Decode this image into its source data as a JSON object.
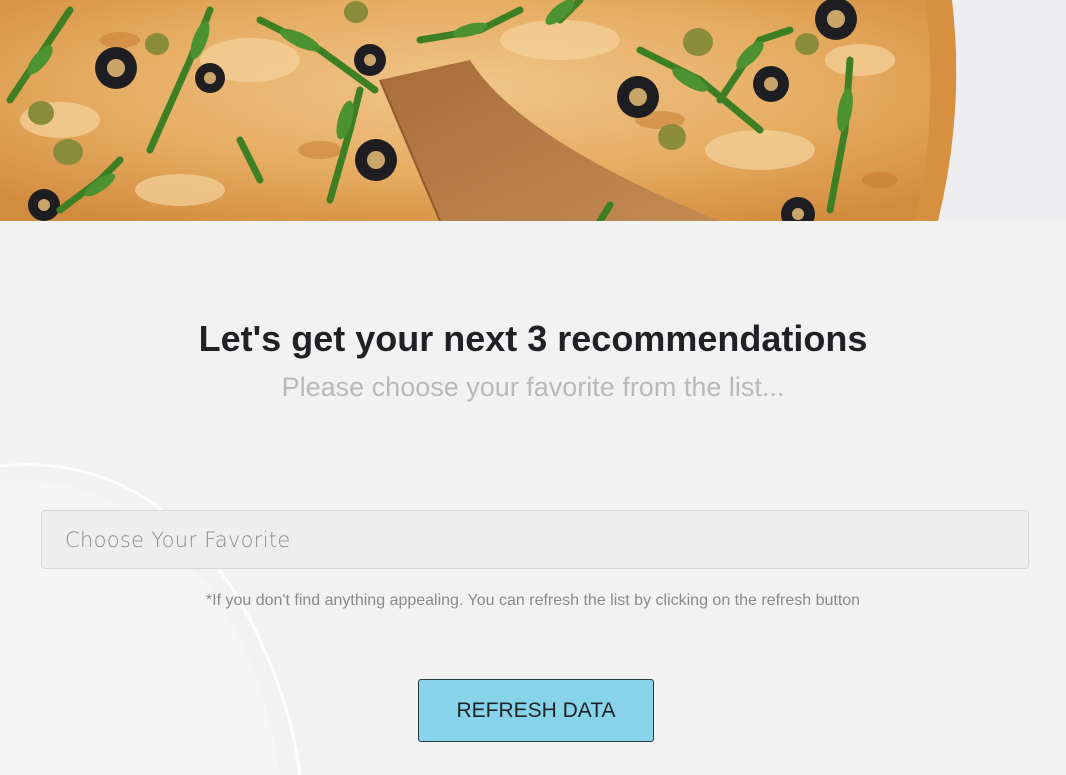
{
  "hero": {
    "image": "pizza-photo",
    "colors": {
      "cheese": "#e7b166",
      "board": "#b07a45",
      "crust": "#d99447",
      "olive": "#1e1e22",
      "arugula": "#4a8a2a"
    }
  },
  "main": {
    "headline": "Let's get your next 3 recommendations",
    "subheadline": "Please choose your favorite from the list...",
    "select_placeholder": "Choose Your Favorite",
    "hint": "*If you don't find anything appealing. You can refresh the list by clicking on the refresh button",
    "refresh_label": "REFRESH DATA"
  },
  "colors": {
    "background": "#f2f2f2",
    "headline": "#1f2125",
    "subheadline": "#b9b9b9",
    "button": "#86d3ea"
  }
}
